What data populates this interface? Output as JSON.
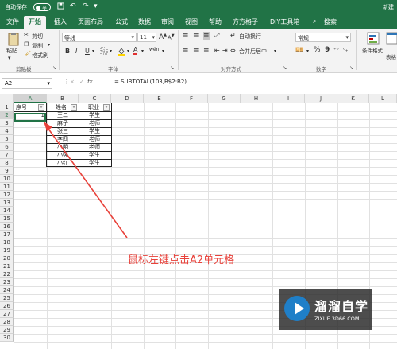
{
  "titlebar": {
    "autosave": "自动保存",
    "toggle": "关",
    "save_icon": "save-icon",
    "undo_icon": "undo-icon",
    "redo_icon": "redo-icon",
    "right": "新建",
    "accent": "#217346"
  },
  "tabs": [
    "文件",
    "开始",
    "插入",
    "页面布局",
    "公式",
    "数据",
    "审阅",
    "视图",
    "帮助",
    "方方格子",
    "DIY工具箱"
  ],
  "search": "搜索",
  "ribbon": {
    "paste": "粘贴",
    "cut": "剪切",
    "copy": "复制",
    "format_painter": "格式刷",
    "clipboard": "剪贴板",
    "font_name": "等线",
    "font_size": "11",
    "grow": "A",
    "shrink": "A",
    "bold": "B",
    "italic": "I",
    "underline": "U",
    "font_color": "A",
    "phonetic": "wén",
    "font_group": "字体",
    "wrap": "自动换行",
    "merge": "合并后居中",
    "align_group": "对齐方式",
    "number_format": "常规",
    "percent": "%",
    "comma": "9",
    "number_group": "数字",
    "conditional": "条件格式",
    "table_format": "表格"
  },
  "formulabar": {
    "namebox": "A2",
    "cancel": "×",
    "enter": "✓",
    "fx": "fx",
    "formula": "= SUBTOTAL(103,B$2:B2)"
  },
  "columns": [
    "A",
    "B",
    "C",
    "D",
    "E",
    "F",
    "G",
    "H",
    "I",
    "J",
    "K",
    "L"
  ],
  "rows": [
    "1",
    "2",
    "3",
    "4",
    "5",
    "6",
    "7",
    "8",
    "9",
    "10",
    "11",
    "12",
    "13",
    "14",
    "15",
    "16",
    "17",
    "18",
    "19",
    "20",
    "21",
    "22",
    "23",
    "24",
    "25",
    "26",
    "27",
    "28",
    "29",
    "30"
  ],
  "table": {
    "headers": [
      "序号",
      "姓名",
      "职业"
    ],
    "A2": "1",
    "names": [
      "王二",
      "麻子",
      "张三",
      "李四",
      "小明",
      "小强",
      "小红"
    ],
    "jobs": [
      "学生",
      "老师",
      "学生",
      "老师",
      "老师",
      "学生",
      "学生"
    ]
  },
  "annotation": {
    "text": "鼠标左键点击A2单元格",
    "color": "#e8413a"
  },
  "watermark": {
    "brand": "溜溜自学",
    "url": "ZIXUE.3D66.COM"
  }
}
